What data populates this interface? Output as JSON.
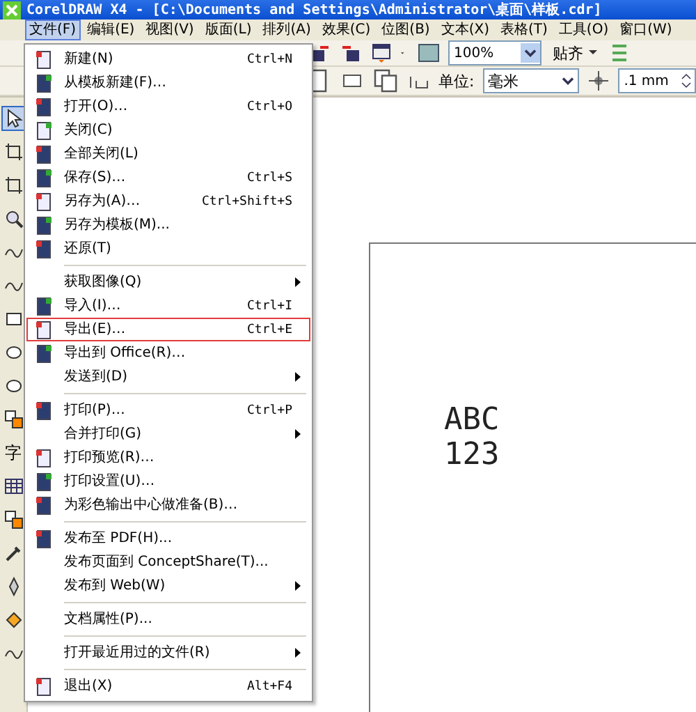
{
  "window": {
    "title": "CorelDRAW X4 - [C:\\Documents and Settings\\Administrator\\桌面\\样板.cdr]"
  },
  "menubar": [
    {
      "label": "文件(F)",
      "selected": true
    },
    {
      "label": "编辑(E)",
      "selected": false
    },
    {
      "label": "视图(V)",
      "selected": false
    },
    {
      "label": "版面(L)",
      "selected": false
    },
    {
      "label": "排列(A)",
      "selected": false
    },
    {
      "label": "效果(C)",
      "selected": false
    },
    {
      "label": "位图(B)",
      "selected": false
    },
    {
      "label": "文本(X)",
      "selected": false
    },
    {
      "label": "表格(T)",
      "selected": false
    },
    {
      "label": "工具(O)",
      "selected": false
    },
    {
      "label": "窗口(W)",
      "selected": false
    }
  ],
  "toolbar": {
    "zoom": "100%",
    "snap": "贴齐"
  },
  "property_bar": {
    "unit_label": "单位:",
    "unit": "毫米",
    "nudge": ".1 mm"
  },
  "toolbox": [
    {
      "kind": "pick",
      "selected": true
    },
    {
      "kind": "shape",
      "selected": false
    },
    {
      "kind": "crop",
      "selected": false
    },
    {
      "kind": "zoom",
      "selected": false
    },
    {
      "kind": "curve",
      "selected": false
    },
    {
      "kind": "smart",
      "selected": false
    },
    {
      "kind": "rect",
      "selected": false
    },
    {
      "kind": "ellipse",
      "selected": false
    },
    {
      "kind": "ellipse",
      "selected": false
    },
    {
      "kind": "polygon",
      "selected": false
    },
    {
      "kind": "glyph",
      "glyph": "字",
      "selected": false
    },
    {
      "kind": "table",
      "selected": false
    },
    {
      "kind": "blend",
      "selected": false
    },
    {
      "kind": "eyedropper",
      "selected": false
    },
    {
      "kind": "outline",
      "selected": false
    },
    {
      "kind": "fill",
      "selected": false
    },
    {
      "kind": "smart",
      "selected": false
    }
  ],
  "file_menu": [
    {
      "kind": "item",
      "label": "新建(N)",
      "shortcut": "Ctrl+N",
      "icon": true,
      "submenu": false,
      "outlined": false
    },
    {
      "kind": "item",
      "label": "从模板新建(F)…",
      "icon": true,
      "submenu": false,
      "outlined": false
    },
    {
      "kind": "item",
      "label": "打开(O)…",
      "shortcut": "Ctrl+O",
      "icon": true,
      "submenu": false,
      "outlined": false
    },
    {
      "kind": "item",
      "label": "关闭(C)",
      "icon": true,
      "submenu": false,
      "outlined": false
    },
    {
      "kind": "item",
      "label": "全部关闭(L)",
      "icon": true,
      "submenu": false,
      "outlined": false
    },
    {
      "kind": "item",
      "label": "保存(S)…",
      "shortcut": "Ctrl+S",
      "icon": true,
      "submenu": false,
      "outlined": false
    },
    {
      "kind": "item",
      "label": "另存为(A)…",
      "shortcut": "Ctrl+Shift+S",
      "icon": true,
      "submenu": false,
      "outlined": false
    },
    {
      "kind": "item",
      "label": "另存为模板(M)...",
      "icon": true,
      "submenu": false,
      "outlined": false
    },
    {
      "kind": "item",
      "label": "还原(T)",
      "icon": true,
      "submenu": false,
      "outlined": false
    },
    {
      "kind": "separator"
    },
    {
      "kind": "item",
      "label": "获取图像(Q)",
      "icon": false,
      "submenu": true,
      "outlined": false
    },
    {
      "kind": "item",
      "label": "导入(I)…",
      "shortcut": "Ctrl+I",
      "icon": true,
      "submenu": false,
      "outlined": false
    },
    {
      "kind": "item",
      "label": "导出(E)…",
      "shortcut": "Ctrl+E",
      "icon": true,
      "submenu": false,
      "outlined": true
    },
    {
      "kind": "item",
      "label": "导出到 Office(R)…",
      "icon": true,
      "submenu": false,
      "outlined": false
    },
    {
      "kind": "item",
      "label": "发送到(D)",
      "icon": false,
      "submenu": true,
      "outlined": false
    },
    {
      "kind": "separator"
    },
    {
      "kind": "item",
      "label": "打印(P)…",
      "shortcut": "Ctrl+P",
      "icon": true,
      "submenu": false,
      "outlined": false
    },
    {
      "kind": "item",
      "label": "合并打印(G)",
      "icon": false,
      "submenu": true,
      "outlined": false
    },
    {
      "kind": "item",
      "label": "打印预览(R)…",
      "icon": true,
      "submenu": false,
      "outlined": false
    },
    {
      "kind": "item",
      "label": "打印设置(U)…",
      "icon": true,
      "submenu": false,
      "outlined": false
    },
    {
      "kind": "item",
      "label": "为彩色输出中心做准备(B)…",
      "icon": true,
      "submenu": false,
      "outlined": false
    },
    {
      "kind": "separator"
    },
    {
      "kind": "item",
      "label": "发布至 PDF(H)...",
      "icon": true,
      "submenu": false,
      "outlined": false
    },
    {
      "kind": "item",
      "label": "发布页面到 ConceptShare(T)...",
      "icon": false,
      "submenu": false,
      "outlined": false
    },
    {
      "kind": "item",
      "label": "发布到 Web(W)",
      "icon": false,
      "submenu": true,
      "outlined": false
    },
    {
      "kind": "separator"
    },
    {
      "kind": "item",
      "label": "文档属性(P)...",
      "icon": false,
      "submenu": false,
      "outlined": false
    },
    {
      "kind": "separator"
    },
    {
      "kind": "item",
      "label": "打开最近用过的文件(R)",
      "icon": false,
      "submenu": true,
      "outlined": false
    },
    {
      "kind": "separator"
    },
    {
      "kind": "item",
      "label": "退出(X)",
      "shortcut": "Alt+F4",
      "icon": true,
      "submenu": false,
      "outlined": false
    }
  ],
  "canvas": {
    "lines": [
      "ABC",
      "123"
    ]
  }
}
